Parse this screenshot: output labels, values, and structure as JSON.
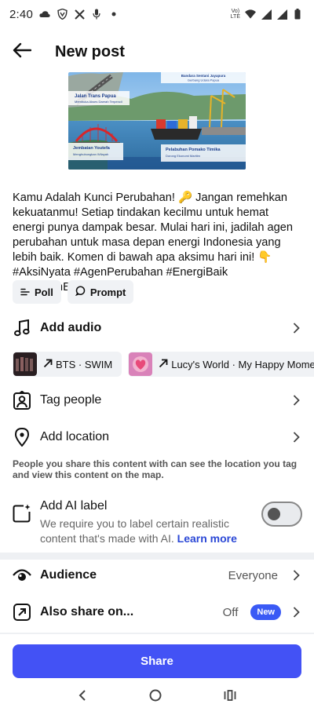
{
  "status_bar": {
    "time": "2:40",
    "volte_line1": "Vo)",
    "volte_line2": "LTE"
  },
  "header": {
    "title": "New post"
  },
  "preview": {
    "banner_top_right_1": "Bandara Sentani Jayapura",
    "banner_top_right_2": "Gerbang Udara Papua",
    "banner_left_title": "Jalan Trans Papua",
    "banner_left_sub": "Membuka Akses Daerah Terpencil",
    "banner_bottom_left_title": "Jembatan Youtefa",
    "banner_bottom_left_sub": "Menghubungkan Wilayah",
    "banner_bottom_right_title": "Pelabuhan Pomako Timika",
    "banner_bottom_right_sub": "Dorong Ekonomi Maritim"
  },
  "caption": {
    "text": "Kamu Adalah Kunci Perubahan! 🔑 Jangan remehkan kekuatanmu! Setiap tindakan kecilmu untuk hemat energi punya dampak besar. Mulai hari ini, jadilah agen perubahan untuk masa depan energi Indonesia yang lebih baik. Komen di bawah apa aksimu hari ini! 👇 #AksiNyata #AgenPerubahan #EnergiBaik #ProgramESDM"
  },
  "chips": {
    "poll": "Poll",
    "prompt": "Prompt"
  },
  "audio": {
    "label": "Add audio",
    "tracks": [
      {
        "name": "BTS · SWIM"
      },
      {
        "name": "Lucy's World · My Happy Moment"
      }
    ]
  },
  "tag_people": {
    "label": "Tag people"
  },
  "location": {
    "label": "Add location",
    "note": "People you share this content with can see the location you tag and view this content on the map."
  },
  "ai_label": {
    "title": "Add AI label",
    "desc": "We require you to label certain realistic content that's made with AI.",
    "link": "Learn more",
    "toggle_on": false
  },
  "audience": {
    "label": "Audience",
    "value": "Everyone"
  },
  "also_share": {
    "label": "Also share on...",
    "value": "Off",
    "badge": "New"
  },
  "share_button": "Share",
  "colors": {
    "accent": "#4352f5",
    "link": "#2b48d6",
    "chip_bg": "#f0f2f5"
  }
}
